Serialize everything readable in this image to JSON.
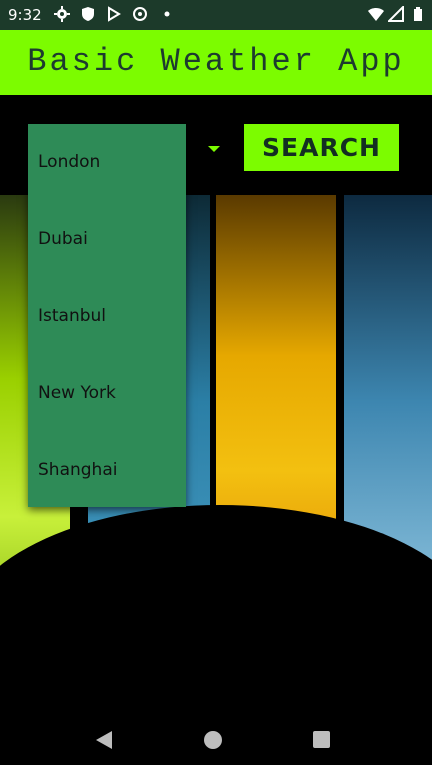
{
  "status_bar": {
    "time": "9:32",
    "left_icons": [
      "gear-icon",
      "shield-icon",
      "play-store-icon",
      "data-saver-icon",
      "dot-icon"
    ],
    "right_icons": [
      "wifi-icon",
      "signal-icon",
      "battery-icon"
    ]
  },
  "app_bar": {
    "title": "Basic Weather App"
  },
  "search": {
    "button_label": "SEARCH"
  },
  "city_dropdown": {
    "options": [
      "London",
      "Dubai",
      "Istanbul",
      "New York",
      "Shanghai"
    ]
  },
  "colors": {
    "accent": "#7cfc00",
    "dropdown_bg": "#2e8b57",
    "status_bar_bg": "#1c3a2a"
  },
  "nav_bar": {
    "icons": [
      "back-icon",
      "home-icon",
      "recents-icon"
    ]
  }
}
